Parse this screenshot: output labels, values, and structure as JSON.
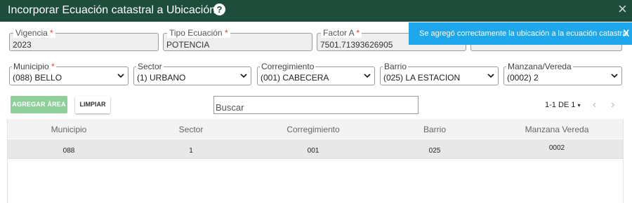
{
  "dialog": {
    "title": "Incorporar Ecuación catastral a Ubicación",
    "help_icon": "?",
    "close_icon": "×"
  },
  "toast": {
    "message": "Se agregó correctamente la ubicación a la ecuación catastral",
    "close": "X",
    "color": "#1ea7ea"
  },
  "fields": {
    "vigencia": {
      "label": "Vigencia",
      "required": "*",
      "value": "2023"
    },
    "tipo_ecuacion": {
      "label": "Tipo Ecuación",
      "required": "*",
      "value": "POTENCIA"
    },
    "factor_a": {
      "label": "Factor A",
      "required": "*",
      "value": "7501.71393626905"
    }
  },
  "filters": {
    "municipio": {
      "label": "Municipio",
      "required": "*",
      "value": "(088) BELLO"
    },
    "sector": {
      "label": "Sector",
      "value": "(1) URBANO"
    },
    "corregimiento": {
      "label": "Corregimiento",
      "value": "(001) CABECERA"
    },
    "barrio": {
      "label": "Barrio",
      "value": "(025) LA ESTACION"
    },
    "manzana_vereda": {
      "label": "Manzana/Vereda",
      "value": "(0002) 2"
    }
  },
  "actions": {
    "agregar_area": "AGREGAR ÁREA",
    "limpiar": "LIMPIAR"
  },
  "search": {
    "placeholder": "Buscar"
  },
  "pagination": {
    "label": "1-1 DE 1",
    "caret": "▾",
    "prev": "‹",
    "next": "›"
  },
  "table": {
    "columns": [
      "Municipio",
      "Sector",
      "Corregimiento",
      "Barrio",
      "Manzana Vereda"
    ],
    "rows": [
      [
        "088",
        "1",
        "001",
        "025",
        "0002"
      ]
    ]
  },
  "colors": {
    "titlebar": "#1e4d3c",
    "accent_green": "#8fcf9c",
    "required": "#e53935"
  }
}
